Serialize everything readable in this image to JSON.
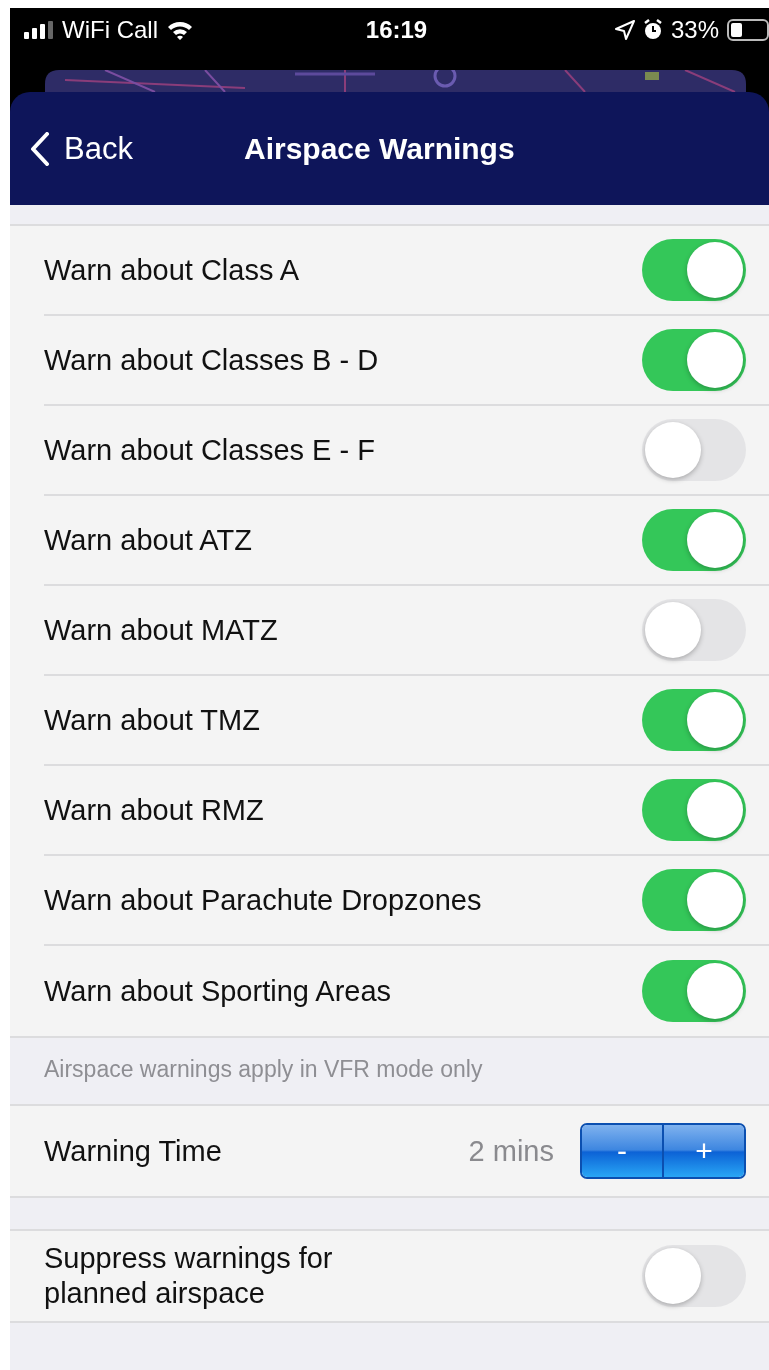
{
  "status_bar": {
    "carrier": "WiFi Call",
    "time": "16:19",
    "battery": "33%"
  },
  "nav": {
    "back": "Back",
    "title": "Airspace Warnings"
  },
  "warnings": [
    {
      "label": "Warn about Class A",
      "on": true
    },
    {
      "label": "Warn about Classes B - D",
      "on": true
    },
    {
      "label": "Warn about Classes E - F",
      "on": false
    },
    {
      "label": "Warn about ATZ",
      "on": true
    },
    {
      "label": "Warn about MATZ",
      "on": false
    },
    {
      "label": "Warn about TMZ",
      "on": true
    },
    {
      "label": "Warn about RMZ",
      "on": true
    },
    {
      "label": "Warn about Parachute Dropzones",
      "on": true
    },
    {
      "label": "Warn about Sporting Areas",
      "on": true
    }
  ],
  "footnote": "Airspace warnings apply in VFR mode only",
  "warning_time": {
    "label": "Warning Time",
    "value": "2 mins",
    "decrement": "-",
    "increment": "+"
  },
  "suppress": {
    "label": "Suppress warnings for planned airspace",
    "on": false
  }
}
